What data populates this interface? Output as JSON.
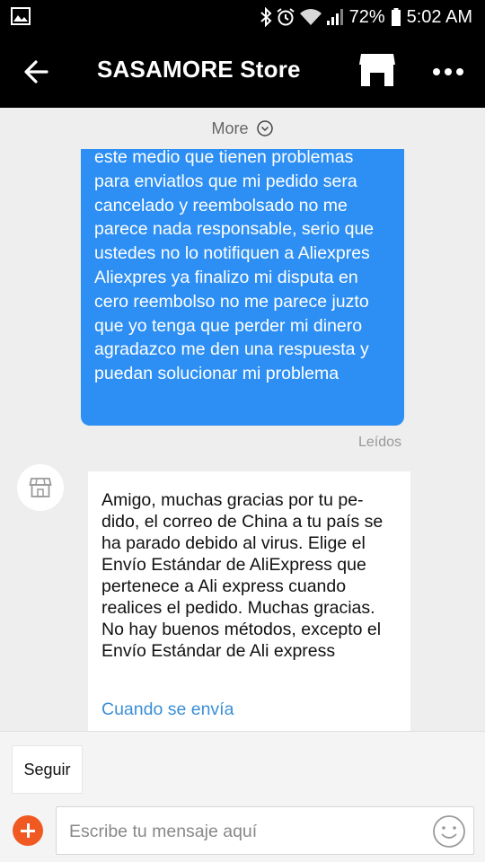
{
  "status_bar": {
    "battery": "72%",
    "time": "5:02 AM"
  },
  "header": {
    "title": "SASAMORE Store",
    "icons": [
      "back-arrow-icon",
      "store-icon",
      "more-options-icon"
    ]
  },
  "chat": {
    "more_label": "More",
    "outgoing_message": "este medio que tienen problemas para enviatlos que mi pedido sera cancelado y reembolsado no me parece nada responsable, serio que ustedes no lo notifiquen a Aliexpres Aliexpres ya finalizo mi disputa en cero reembolso no me parece juzto que yo tenga que perder mi dinero agradazco me den una respuesta y puedan solucionar mi problema",
    "read_status": "Leídos",
    "incoming_message": "Amigo, muchas gracias por tu pe-dido, el correo de China a tu país se ha parado debido al virus. Elige el Envío Estándar de AliExpress que pertenece a Ali express cuando realices el pedido. Muchas gracias. No hay buenos métodos, excepto el Envío Estándar de Ali express",
    "incoming_link": "Cuando se envía"
  },
  "footer": {
    "follow_label": "Seguir",
    "input_placeholder": "Escribe tu mensaje aquí"
  },
  "colors": {
    "outgoing_bubble": "#2d8ff3",
    "link": "#3a8fd6",
    "plus_button": "#f05a22",
    "header_bg": "#000000"
  }
}
